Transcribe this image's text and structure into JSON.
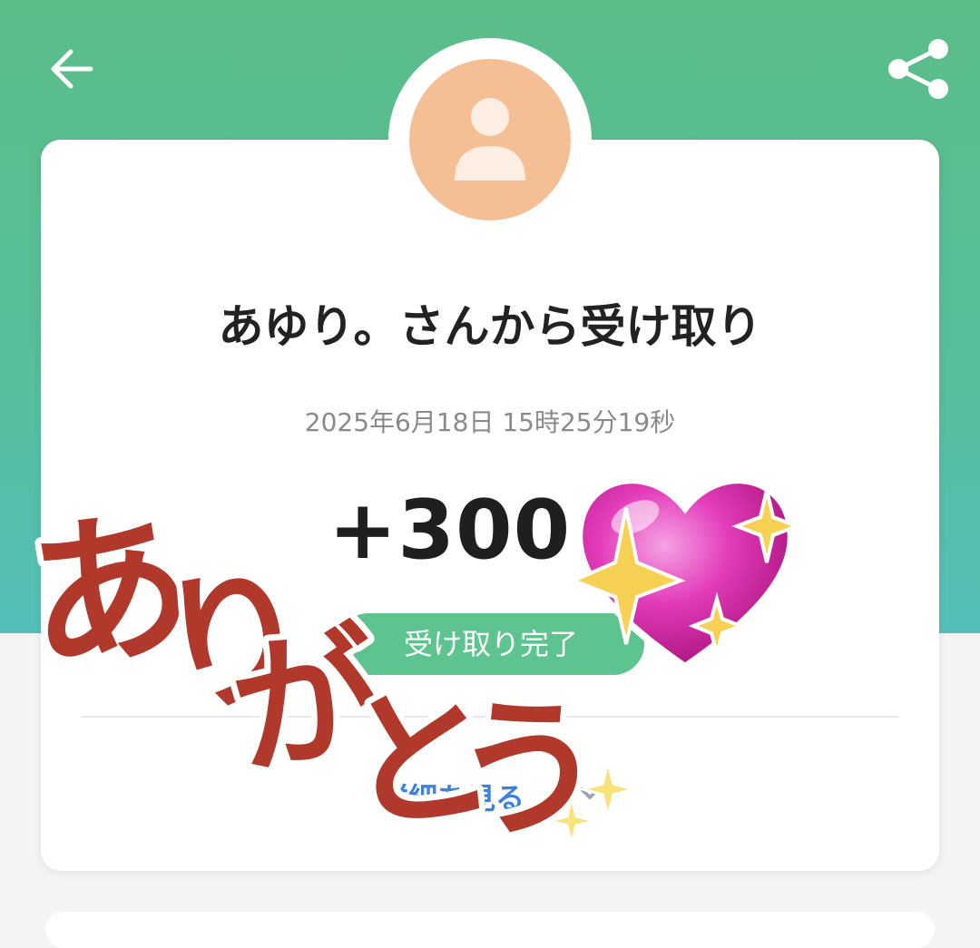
{
  "header": {
    "back_icon": "arrow-left-icon",
    "share_icon": "share-icon"
  },
  "card": {
    "avatar_icon": "person-icon",
    "title": "あゆり。さんから受け取り",
    "date": "2025年6月18日 15時25分19秒",
    "amount": "+300",
    "status": "受け取り完了",
    "details_link": "詳細を見る",
    "details_icon": "chevron-down-icon"
  },
  "sticker": {
    "text": "ありがとう",
    "heart_icon": "sparkling-heart-icon",
    "sparkle_icon": "sparkles-icon"
  },
  "colors": {
    "header_green": "#5abd88",
    "avatar_orange": "#f5bf95",
    "status_green": "#5ec48f",
    "link_blue": "#3b82e0",
    "sticker_red": "#b0392b",
    "heart_pink": "#e23ab8"
  }
}
